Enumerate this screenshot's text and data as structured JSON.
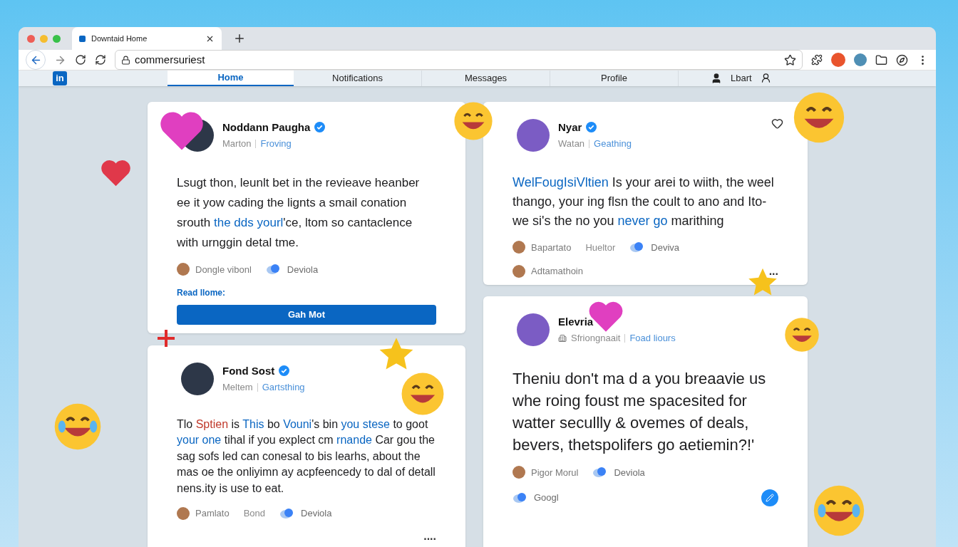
{
  "browser": {
    "tab_title": "Downtaid Home",
    "url": "commersuriest"
  },
  "nav": {
    "logo": "in",
    "tabs": [
      {
        "label": "Home",
        "selected": true
      },
      {
        "label": "Notifications",
        "selected": false
      },
      {
        "label": "Messages",
        "selected": false
      },
      {
        "label": "Profile",
        "selected": false
      }
    ],
    "user": "Lbart"
  },
  "feed_columns": [
    {
      "posts": [
        {
          "name": "Noddann Paugha",
          "verified": true,
          "heart": false,
          "role_icon": false,
          "role": "Marton",
          "tag": "Froving",
          "body": [
            {
              "text": "Lsugt thon, leunlt bet in the revieave heanber ee it yow cading the lignts a smail conation srouth ",
              "color": "#1d1d1f"
            },
            {
              "text": "the dds yourl",
              "color": "#0a66c2"
            },
            {
              "text": "'ce, ltom so cantaclence with urnggin detal tme.",
              "color": "#1d1d1f"
            }
          ],
          "reactions": [
            {
              "kind": "person",
              "label": "Dongle vibonl"
            },
            {
              "kind": "app",
              "label": "Deviola"
            }
          ],
          "link": "Read llome:",
          "button": "Gah Mot",
          "edit_button": false
        },
        {
          "name": "Fond Sost",
          "verified": true,
          "heart": false,
          "role_icon": false,
          "role": "Meltem",
          "tag": "Gartsthing",
          "body": [
            {
              "text": "Tlo ",
              "color": "#1d1d1f"
            },
            {
              "text": "Sptien",
              "color": "#c0392b"
            },
            {
              "text": " is ",
              "color": "#1d1d1f"
            },
            {
              "text": "This",
              "color": "#0a66c2"
            },
            {
              "text": " bo ",
              "color": "#1d1d1f"
            },
            {
              "text": "Vouni",
              "color": "#0a66c2"
            },
            {
              "text": "'s bin ",
              "color": "#1d1d1f"
            },
            {
              "text": "you stese",
              "color": "#0a66c2"
            },
            {
              "text": " to goot ",
              "color": "#1d1d1f"
            },
            {
              "text": "your one",
              "color": "#0a66c2"
            },
            {
              "text": " tihal if you explect cm ",
              "color": "#1d1d1f"
            },
            {
              "text": "rnande",
              "color": "#0a66c2"
            },
            {
              "text": " Car gou the sag sofs led can conesal to bis learhs, about the mas oe the onliyimn ay acpfeencedy to dal of detall nens.ity is use to eat.",
              "color": "#1d1d1f"
            }
          ],
          "reactions": [
            {
              "kind": "person",
              "label": "Pamlato"
            },
            {
              "kind": "text",
              "label": "Bond"
            },
            {
              "kind": "app",
              "label": "Deviola"
            }
          ],
          "more": "....",
          "edit_button": false
        }
      ]
    },
    {
      "posts": [
        {
          "name": "Nyar",
          "verified": true,
          "heart": true,
          "role_icon": false,
          "role": "Watan",
          "tag": "Geathing",
          "body": [
            {
              "text": "WelFougIsiVltien",
              "color": "#0a66c2"
            },
            {
              "text": " Is your arei to wiith, the weel thango, your ing flsn the coult to ano and Ito-we si's the no you ",
              "color": "#1d1d1f"
            },
            {
              "text": "never go",
              "color": "#0a66c2"
            },
            {
              "text": " marithing",
              "color": "#1d1d1f"
            }
          ],
          "reactions": [
            {
              "kind": "person",
              "label": "Bapartato"
            },
            {
              "kind": "text",
              "label": "Hueltor"
            },
            {
              "kind": "app",
              "label": "Deviva"
            }
          ],
          "footer": {
            "kind": "person",
            "label": "Adtamathoin"
          },
          "more": "...",
          "edit_button": false
        },
        {
          "name": "Elevria",
          "verified": false,
          "heart": false,
          "role_icon": true,
          "role": "Sfriongnaait",
          "tag": "Foad liours",
          "body": [
            {
              "text": "Theniu don't ma d a you breaavie us whe roing foust me spacesited for watter secullly & ovemes of deals, bevers, thetspolifers go aetiemin?!'",
              "color": "#1d1d1f"
            }
          ],
          "reactions": [
            {
              "kind": "person",
              "label": "Pigor Morul"
            },
            {
              "kind": "app",
              "label": "Deviola"
            }
          ],
          "footer": {
            "kind": "app",
            "label": "Googl"
          },
          "edit_button": true
        }
      ]
    }
  ]
}
